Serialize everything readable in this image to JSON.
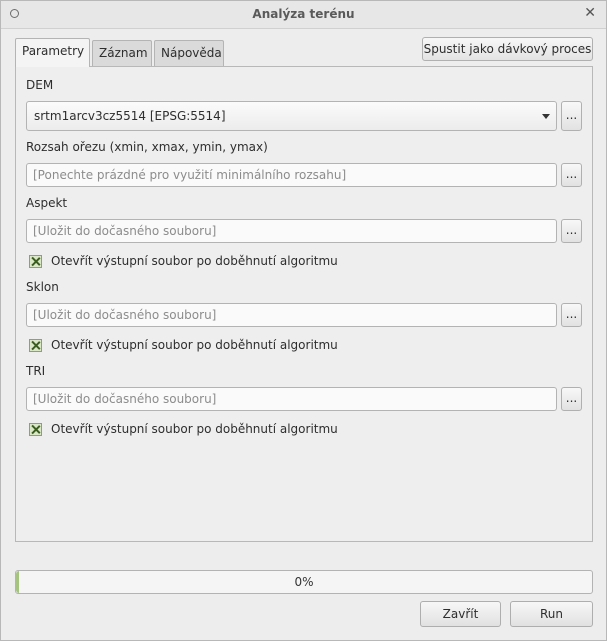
{
  "window": {
    "title": "Analýza terénu"
  },
  "tabs": [
    {
      "label": "Parametry",
      "active": true
    },
    {
      "label": "Záznam",
      "active": false
    },
    {
      "label": "Nápověda",
      "active": false
    }
  ],
  "batch_button": "Spustit jako dávkový proces",
  "params": {
    "dem": {
      "label": "DEM",
      "value": "srtm1arcv3cz5514 [EPSG:5514]",
      "browse": "..."
    },
    "extent": {
      "label": "Rozsah ořezu (xmin, xmax, ymin, ymax)",
      "placeholder": "[Ponechte prázdné pro využití minimálního rozsahu]",
      "browse": "..."
    },
    "aspect": {
      "label": "Aspekt",
      "placeholder": "[Uložit do dočasného souboru]",
      "browse": "...",
      "open_label": "Otevřít výstupní soubor po doběhnutí algoritmu",
      "open_checked": true
    },
    "slope": {
      "label": "Sklon",
      "placeholder": "[Uložit do dočasného souboru]",
      "browse": "...",
      "open_label": "Otevřít výstupní soubor po doběhnutí algoritmu",
      "open_checked": true
    },
    "tri": {
      "label": "TRI",
      "placeholder": "[Uložit do dočasného souboru]",
      "browse": "...",
      "open_label": "Otevřít výstupní soubor po doběhnutí algoritmu",
      "open_checked": true
    }
  },
  "progress": {
    "text": "0%",
    "value": 0
  },
  "buttons": {
    "close": "Zavřít",
    "run": "Run"
  },
  "colors": {
    "check_fill": "#dbe8c8",
    "progress_accent": "#9cbf6c"
  }
}
